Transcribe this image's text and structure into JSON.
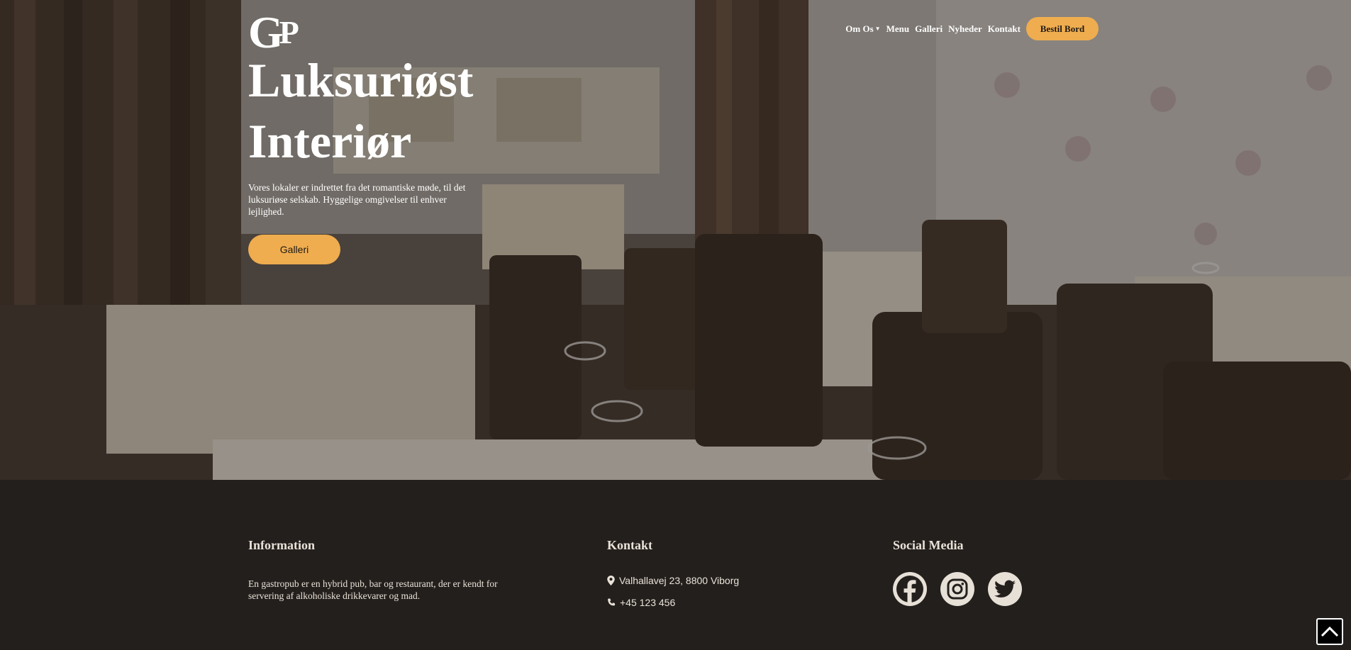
{
  "nav": {
    "logo": {
      "g": "G",
      "p": "P"
    },
    "links": [
      {
        "label": "Om Os",
        "has_dropdown": true
      },
      {
        "label": "Menu"
      },
      {
        "label": "Galleri"
      },
      {
        "label": "Nyheder"
      },
      {
        "label": "Kontakt"
      }
    ],
    "book_button": "Bestil Bord"
  },
  "hero": {
    "title_line1": "Luksuriøst",
    "title_line2": "Interiør",
    "text": "Vores lokaler er indrettet fra det romantiske møde, til det luksuriøse selskab. Hyggelige omgivelser til enhver lejlighed.",
    "button": "Galleri"
  },
  "footer": {
    "info": {
      "heading": "Information",
      "text": "En gastropub er en hybrid pub, bar og restaurant, der er kendt for servering af alkoholiske drikkevarer og mad."
    },
    "contact": {
      "heading": "Kontakt",
      "address": "Valhallavej 23, 8800 Viborg",
      "phone": "+45 123 456",
      "address_icon": "location-pin-icon",
      "phone_icon": "phone-icon"
    },
    "social": {
      "heading": "Social Media",
      "icons": [
        "facebook-icon",
        "instagram-icon",
        "twitter-icon"
      ]
    }
  },
  "scroll_top_icon": "chevron-up-icon",
  "colors": {
    "accent": "#efad4f",
    "footer_bg": "#231f1c",
    "footer_text": "#e9e2d8",
    "social_bg": "#e7e0d7"
  }
}
